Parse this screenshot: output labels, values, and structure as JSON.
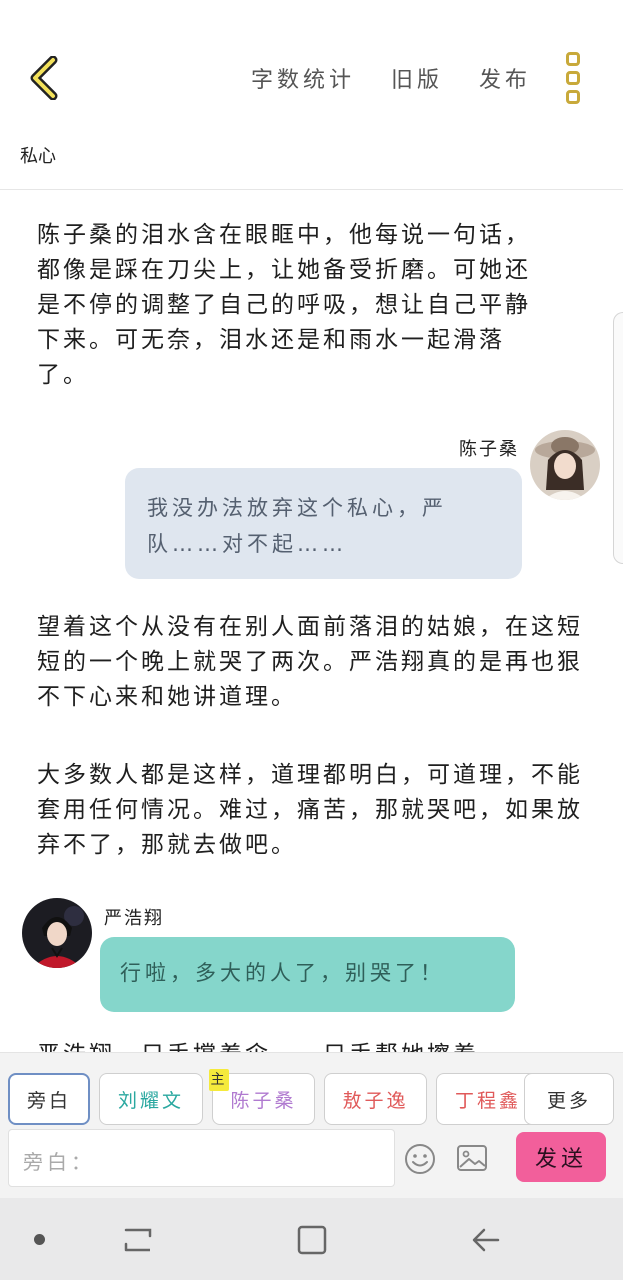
{
  "header": {
    "back_icon": "chevron-left-icon",
    "actions": [
      "字数统计",
      "旧版",
      "发布"
    ],
    "more_icon": "more-vertical-icon",
    "accent_color": "#c8a93a"
  },
  "document": {
    "title": "私心"
  },
  "story": {
    "narration_1": "陈子桑的泪水含在眼眶中，他每说一句话，都像是踩在刀尖上，让她备受折磨。可她还是不停的调整了自己的呼吸，想让自己平静下来。可无奈，泪水还是和雨水一起滑落了。",
    "dialogue_1": {
      "speaker": "陈子桑",
      "text": "我没办法放弃这个私心，严队……对不起……",
      "bubble_color": "#dfe6ef"
    },
    "narration_2": "望着这个从没有在别人面前落泪的姑娘，在这短短的一个晚上就哭了两次。严浩翔真的是再也狠不下心来和她讲道理。",
    "narration_3": "大多数人都是这样，道理都明白，可道理，不能套用任何情况。难过，痛苦，那就哭吧，如果放弃不了，那就去做吧。",
    "dialogue_2": {
      "speaker": "严浩翔",
      "text": "行啦，多大的人了，别哭了！",
      "bubble_color": "#85d6cb"
    },
    "narration_4": "严浩翔一只手撑着伞，一只手帮她擦着"
  },
  "composer": {
    "roles": [
      {
        "label": "旁白",
        "color": "#333333"
      },
      {
        "label": "刘耀文",
        "color": "#2aa8a0"
      },
      {
        "label": "陈子桑",
        "color": "#b07ad0",
        "badge": "主"
      },
      {
        "label": "敖子逸",
        "color": "#e05a5a"
      },
      {
        "label": "丁程鑫",
        "color": "#e05a5a"
      },
      {
        "label": "更多",
        "color": "#333333"
      }
    ],
    "input_placeholder": "旁白：",
    "emoji_icon": "emoji-icon",
    "image_icon": "image-icon",
    "send_label": "发送",
    "send_color": "#f25f9b"
  },
  "system_nav": {
    "icons": [
      "dot-icon",
      "recent-apps-icon",
      "home-icon",
      "back-arrow-icon"
    ]
  }
}
